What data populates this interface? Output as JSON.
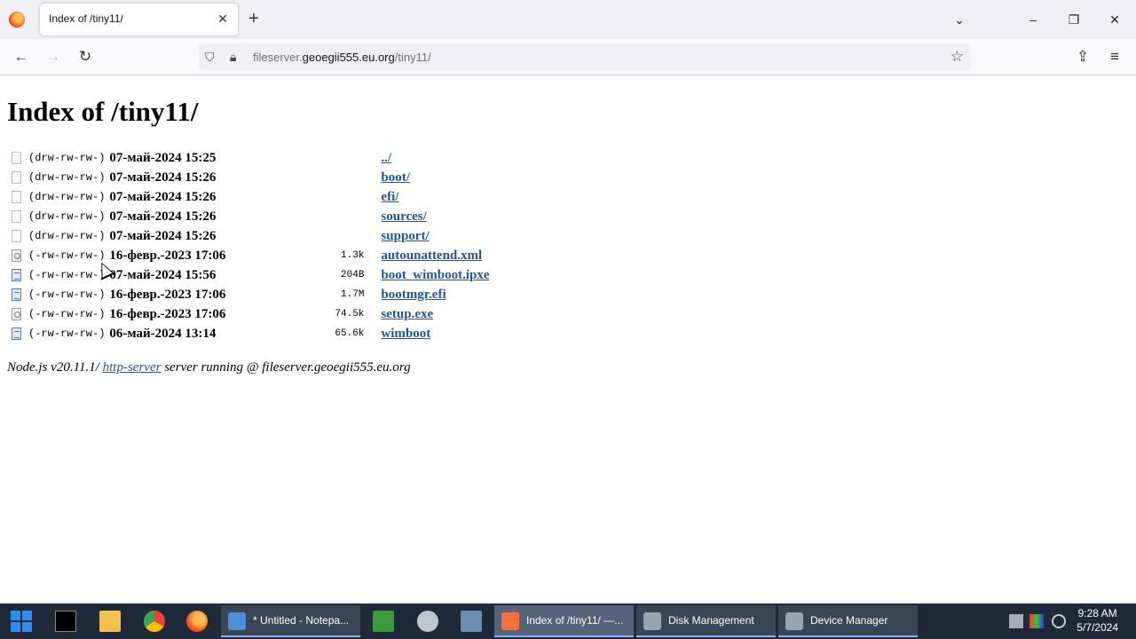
{
  "browser": {
    "tab_title": "Index of /tiny11/",
    "tab_close": "✕",
    "new_tab": "+",
    "url_prefix": "fileserver.",
    "url_host": "geoegii555.eu.org",
    "url_path": "/tiny11/"
  },
  "page": {
    "title": "Index of /tiny11/",
    "entries": [
      {
        "icon": "file-blank",
        "perm": "(drw-rw-rw-)",
        "date": "07-май-2024 15:25",
        "size": "",
        "name": "../"
      },
      {
        "icon": "file-blank",
        "perm": "(drw-rw-rw-)",
        "date": "07-май-2024 15:26",
        "size": "",
        "name": "boot/"
      },
      {
        "icon": "file-blank",
        "perm": "(drw-rw-rw-)",
        "date": "07-май-2024 15:26",
        "size": "",
        "name": "efi/"
      },
      {
        "icon": "file-blank",
        "perm": "(drw-rw-rw-)",
        "date": "07-май-2024 15:26",
        "size": "",
        "name": "sources/"
      },
      {
        "icon": "file-blank",
        "perm": "(drw-rw-rw-)",
        "date": "07-май-2024 15:26",
        "size": "",
        "name": "support/"
      },
      {
        "icon": "file-xml",
        "perm": "(-rw-rw-rw-)",
        "date": "16-февр.-2023 17:06",
        "size": "1.3k",
        "name": "autounattend.xml"
      },
      {
        "icon": "file-doc",
        "perm": "(-rw-rw-rw-)",
        "date": "07-май-2024 15:56",
        "size": "204B",
        "name": "boot_wimboot.ipxe"
      },
      {
        "icon": "file-doc",
        "perm": "(-rw-rw-rw-)",
        "date": "16-февр.-2023 17:06",
        "size": "1.7M",
        "name": "bootmgr.efi"
      },
      {
        "icon": "file-xml",
        "perm": "(-rw-rw-rw-)",
        "date": "16-февр.-2023 17:06",
        "size": "74.5k",
        "name": "setup.exe"
      },
      {
        "icon": "file-doc",
        "perm": "(-rw-rw-rw-)",
        "date": "06-май-2024 13:14",
        "size": "65.6k",
        "name": "wimboot"
      }
    ],
    "footer": {
      "prefix": "Node.js v20.11.1/ ",
      "link": "http-server",
      "suffix": " server running @ fileserver.geoegii555.eu.org"
    }
  },
  "taskbar": {
    "apps": [
      {
        "label": "* Untitled - Notepa...",
        "icon": "notepad-icon",
        "color": "#4a8fd8"
      },
      {
        "label": "Index of /tiny11/ —...",
        "icon": "firefox-icon",
        "color": "#ff7139"
      },
      {
        "label": "Disk Management",
        "icon": "disk-management-icon",
        "color": "#9aa4b0"
      },
      {
        "label": "Device Manager",
        "icon": "device-manager-icon",
        "color": "#9aa4b0"
      }
    ],
    "time": "9:28 AM",
    "date": "5/7/2024"
  },
  "colors": {
    "link": "#1a56b0",
    "taskbar": "#1e2a3a"
  }
}
